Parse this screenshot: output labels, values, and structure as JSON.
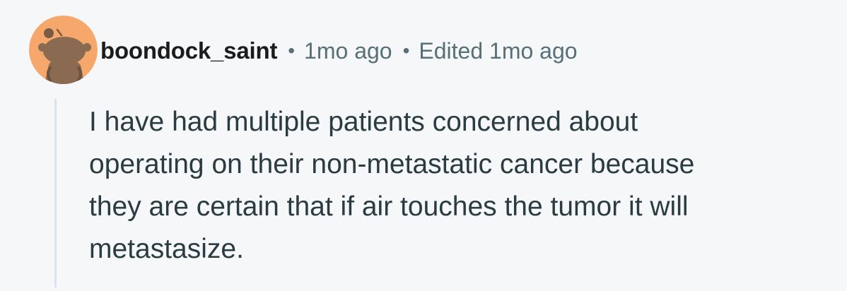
{
  "comment": {
    "author": "boondock_saint",
    "separator": "•",
    "posted": "1mo ago",
    "edited": "Edited 1mo ago",
    "avatar": {
      "icon": "snoo-avatar-icon",
      "background_color": "#f6a86c"
    },
    "body_lines": [
      "I have had multiple patients concerned about",
      "operating on their non-metastatic cancer because",
      "they are certain that if air touches the tumor it will",
      "metastasize."
    ]
  }
}
